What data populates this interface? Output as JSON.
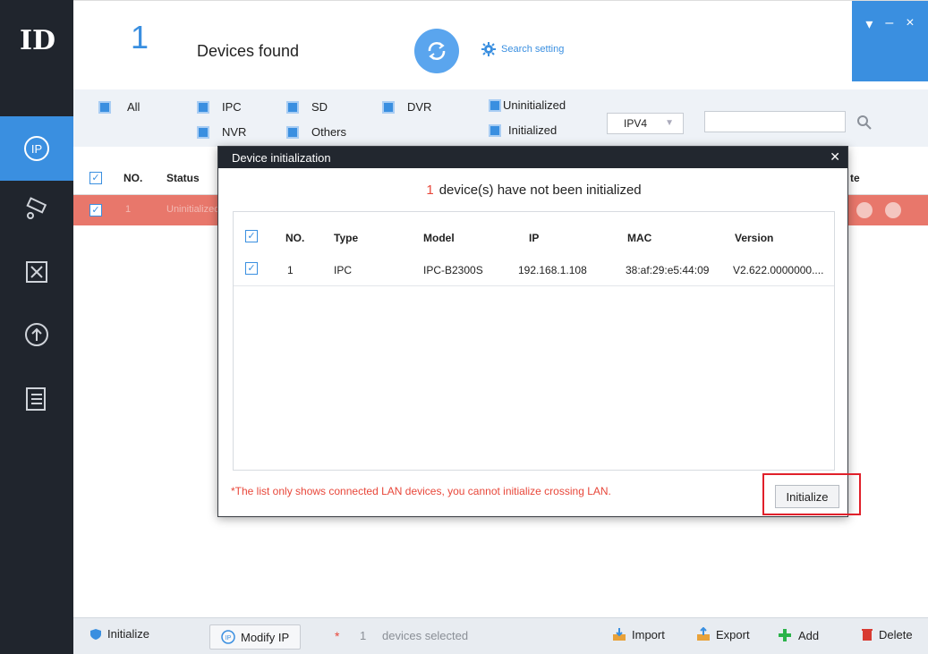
{
  "app": {
    "logo_text": "ID"
  },
  "header": {
    "count": "1",
    "title": "Devices found",
    "search_setting": "Search setting",
    "win_controls": [
      "▾",
      "–",
      "×"
    ]
  },
  "filters": {
    "all": "All",
    "ipc": "IPC",
    "sd": "SD",
    "dvr": "DVR",
    "nvr": "NVR",
    "others": "Others",
    "uninitialized": "Uninitialized",
    "initialized": "Initialized",
    "ip_version": "IPV4"
  },
  "table": {
    "col_no": "NO.",
    "col_status": "Status",
    "col_trailing": "te",
    "row1_no": "1",
    "row1_status": "Uninitialized"
  },
  "modal": {
    "title": "Device initialization",
    "uninit_count": "1",
    "message": "device(s) have not been initialized",
    "columns": [
      "NO.",
      "Type",
      "Model",
      "IP",
      "MAC",
      "Version"
    ],
    "row": {
      "no": "1",
      "type": "IPC",
      "model": "IPC-B2300S",
      "ip": "192.168.1.108",
      "mac": "38:af:29:e5:44:09",
      "version": "V2.622.0000000...."
    },
    "note": "*The list only shows connected LAN devices, you cannot initialize crossing LAN.",
    "initialize_btn": "Initialize"
  },
  "bottom": {
    "initialize": "Initialize",
    "modify_ip": "Modify IP",
    "selected_count": "1",
    "selected_label": "devices selected",
    "import": "Import",
    "export": "Export",
    "add": "Add",
    "delete": "Delete"
  },
  "colors": {
    "accent": "#3a8fe0",
    "sidebar": "#20252d",
    "row_highlight": "#e8776b",
    "warning": "#e8473a"
  }
}
